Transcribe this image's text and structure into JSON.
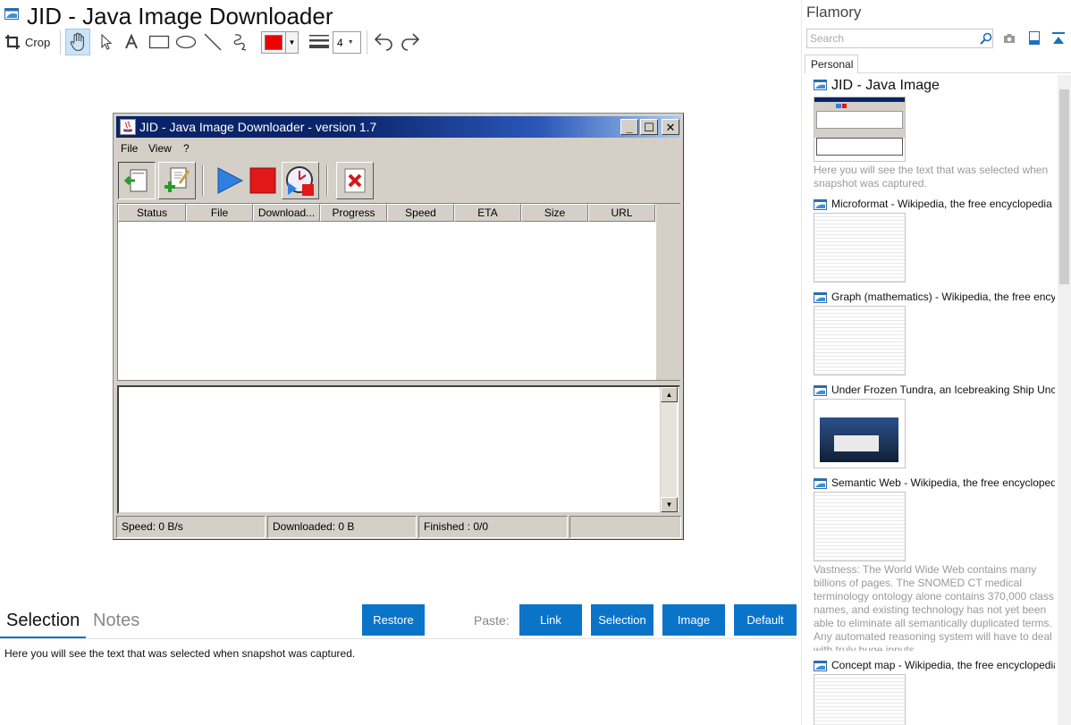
{
  "document": {
    "title": "JID - Java Image Downloader"
  },
  "toolbar": {
    "crop_label": "Crop",
    "line_width": "4"
  },
  "colors": {
    "accent": "#0a74c9",
    "pen_color": "#ee0000",
    "jid_title_bar": "#0a246a"
  },
  "jid_window": {
    "title": "JID - Java Image Downloader - version 1.7",
    "menu": [
      "File",
      "View",
      "?"
    ],
    "columns": [
      "Status",
      "File",
      "Download...",
      "Progress",
      "Speed",
      "ETA",
      "Size",
      "URL"
    ],
    "status": {
      "speed": "Speed: 0 B/s",
      "downloaded": "Downloaded: 0 B",
      "finished": "Finished : 0/0"
    }
  },
  "bottom": {
    "tabs": [
      "Selection",
      "Notes"
    ],
    "restore_label": "Restore",
    "paste_label": "Paste:",
    "paste_buttons": [
      "Link",
      "Selection",
      "Image",
      "Default"
    ],
    "selection_text": "Here you will see the text that was selected when snapshot was captured."
  },
  "sidebar": {
    "title": "Flamory",
    "search_placeholder": "Search",
    "tab": "Personal",
    "items": [
      {
        "title": "JID - Java Image",
        "note": "Here you will see the text that was selected when snapshot was captured."
      },
      {
        "title": "Microformat - Wikipedia, the free encyclopedia"
      },
      {
        "title": "Graph (mathematics) - Wikipedia, the free ency"
      },
      {
        "title": "Under Frozen Tundra, an Icebreaking Ship Unco"
      },
      {
        "title": "Semantic Web - Wikipedia, the free encycloped",
        "note": "Vastness: The World Wide Web contains many billions of pages. The SNOMED CT medical terminology ontology alone contains 370,000 class names, and existing technology has not yet been able to eliminate all semantically duplicated terms. Any automated reasoning system will have to deal with truly huge inputs."
      },
      {
        "title": "Concept map - Wikipedia, the free encyclopedia"
      }
    ]
  }
}
